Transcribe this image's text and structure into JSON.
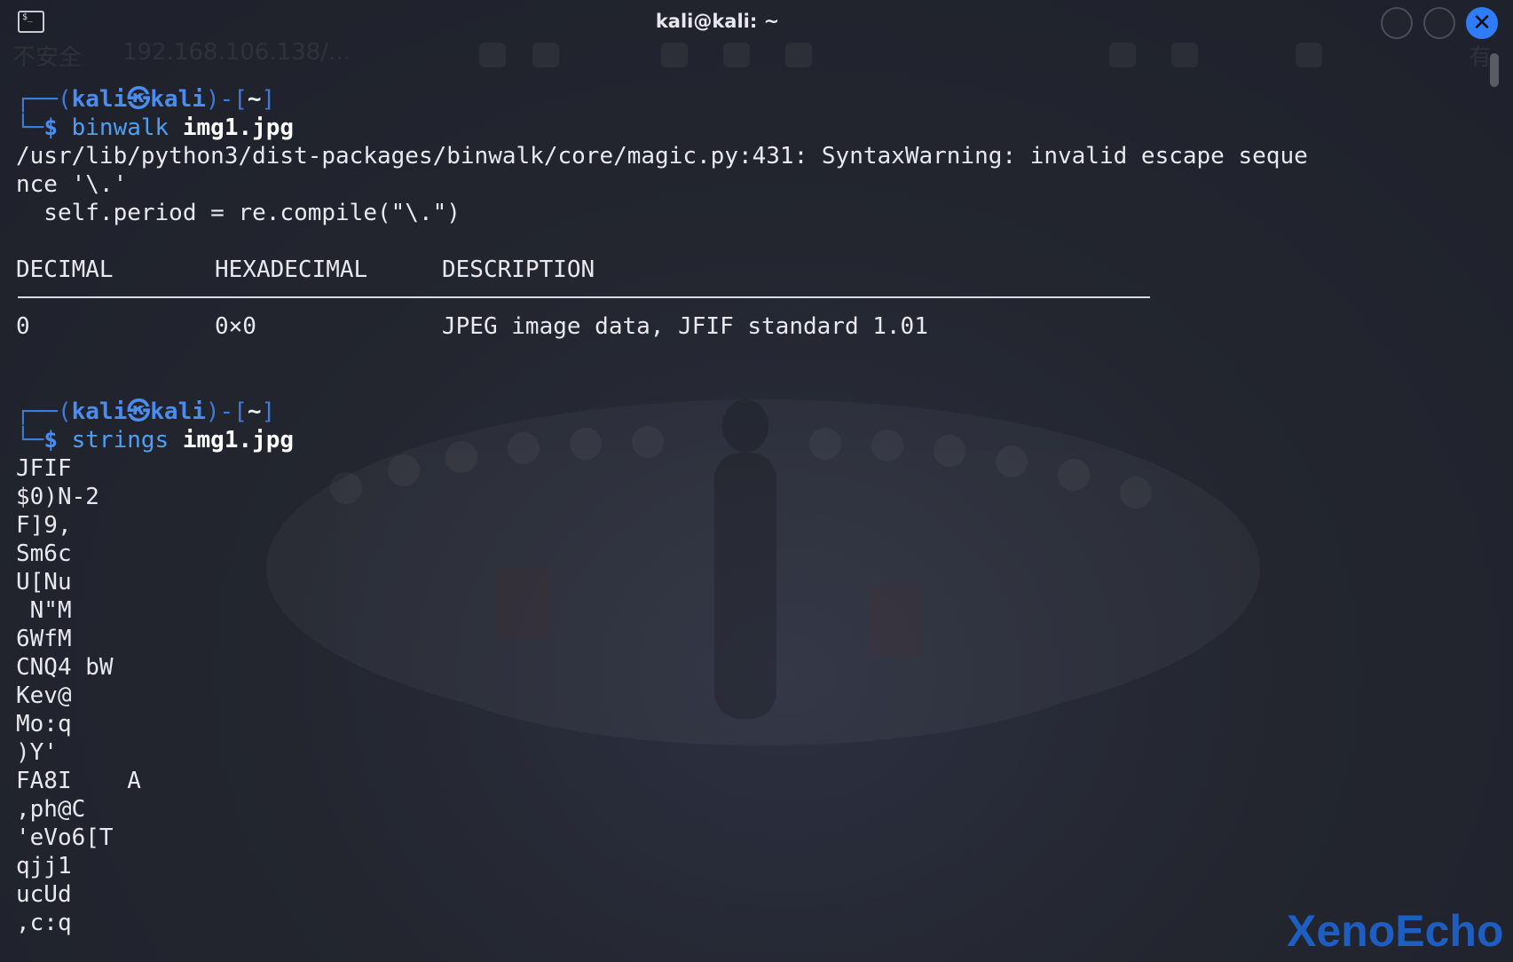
{
  "window": {
    "title": "kali@kali: ~",
    "terminal_icon_label": "$_",
    "close_glyph": "✕"
  },
  "ghost_bar": {
    "insecure_label": "不安全",
    "url": "192.168.106.138/...",
    "right_label": "有"
  },
  "terminal": {
    "session1": {
      "prompt_open": "┌──(",
      "user": "kali",
      "at_symbol": "㉿",
      "host": "kali",
      "prompt_mid": ")-[",
      "cwd": "~",
      "prompt_close": "]",
      "prompt_start": "└─",
      "dollar": "$",
      "command": "binwalk",
      "argument": "img1.jpg",
      "warning_line1": "/usr/lib/python3/dist-packages/binwalk/core/magic.py:431: SyntaxWarning: invalid escape seque",
      "warning_line2": "nce '\\.'",
      "warning_line3": "  self.period = re.compile(\"\\.\")",
      "table": {
        "headers": [
          "DECIMAL",
          "HEXADECIMAL",
          "DESCRIPTION"
        ],
        "rows": [
          [
            "0",
            "0×0",
            "JPEG image data, JFIF standard 1.01"
          ]
        ]
      }
    },
    "session2": {
      "prompt_open": "┌──(",
      "user": "kali",
      "at_symbol": "㉿",
      "host": "kali",
      "prompt_mid": ")-[",
      "cwd": "~",
      "prompt_close": "]",
      "prompt_start": "└─",
      "dollar": "$",
      "command": "strings",
      "argument": "img1.jpg",
      "output": [
        "JFIF",
        "$0)N-2",
        "F]9,",
        "Sm6c",
        "U[Nu",
        " N\"M",
        "6WfM",
        "CNQ4 bW",
        "Kev@",
        "Mo:q",
        ")Y'",
        "FA8I    A",
        ",ph@C",
        "'eVo6[T",
        "qjj1",
        "ucUd",
        ",c:q"
      ]
    }
  },
  "watermark": "XenoEcho",
  "colors": {
    "prompt_blue": "#4a8cf0",
    "close_button": "#2f7cf6",
    "background": "#23262f"
  }
}
